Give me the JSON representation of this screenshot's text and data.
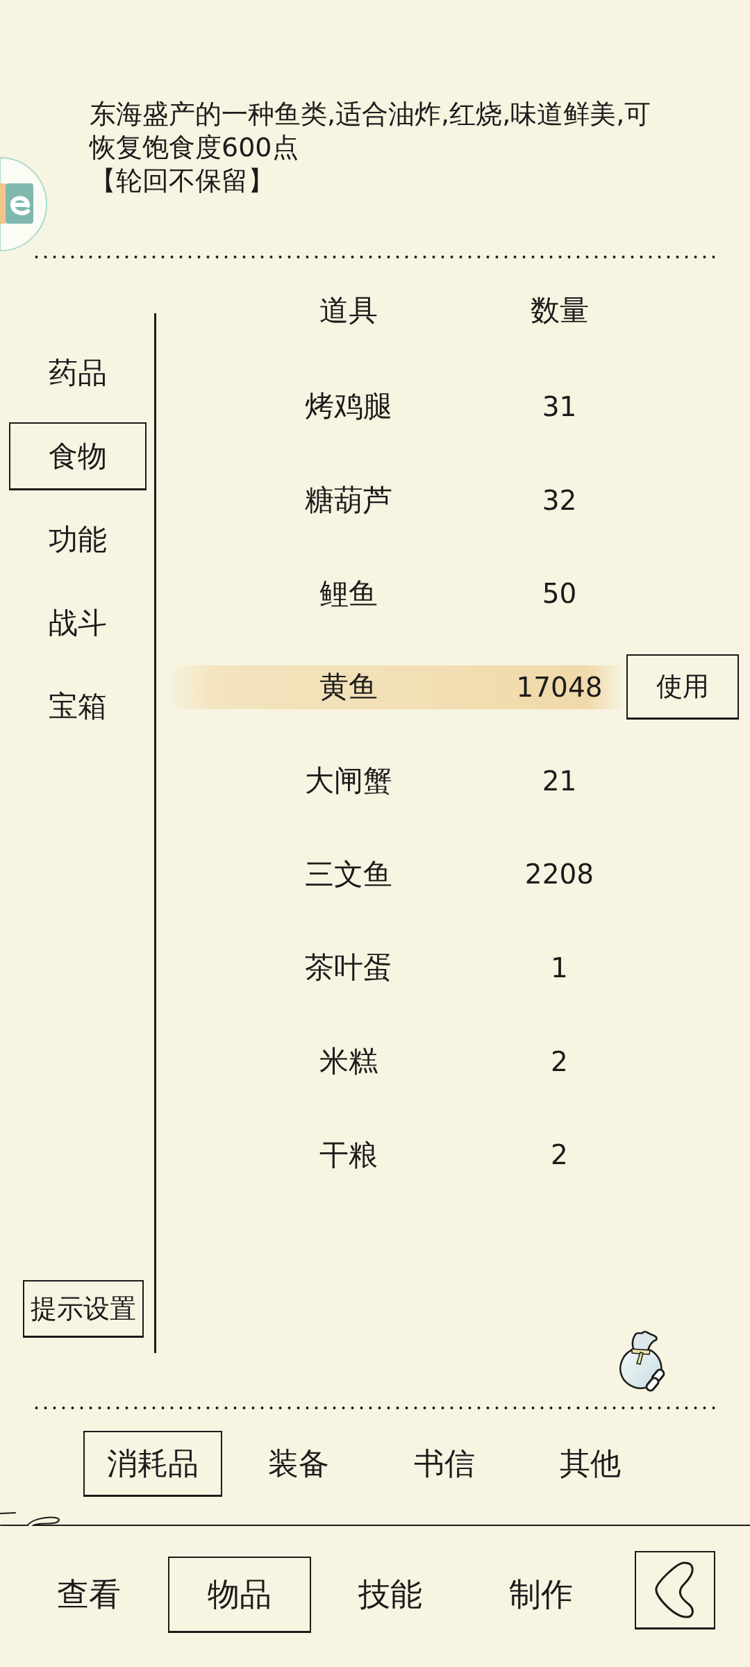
{
  "description": {
    "text": "东海盛产的一种鱼类,适合油炸,红烧,味道鲜美,可恢复饱食度600点",
    "note": "【轮回不保留】"
  },
  "sidebar": {
    "items": [
      {
        "label": "药品",
        "selected": false
      },
      {
        "label": "食物",
        "selected": true
      },
      {
        "label": "功能",
        "selected": false
      },
      {
        "label": "战斗",
        "selected": false
      },
      {
        "label": "宝箱",
        "selected": false
      }
    ],
    "settings_button": "提示设置"
  },
  "table": {
    "columns": [
      "道具",
      "数量"
    ],
    "rows": [
      {
        "name": "烤鸡腿",
        "count": "31",
        "selected": false
      },
      {
        "name": "糖葫芦",
        "count": "32",
        "selected": false
      },
      {
        "name": "鲤鱼",
        "count": "50",
        "selected": false
      },
      {
        "name": "黄鱼",
        "count": "17048",
        "selected": true,
        "action": "使用"
      },
      {
        "name": "大闸蟹",
        "count": "21",
        "selected": false
      },
      {
        "name": "三文鱼",
        "count": "2208",
        "selected": false
      },
      {
        "name": "茶叶蛋",
        "count": "1",
        "selected": false
      },
      {
        "name": "米糕",
        "count": "2",
        "selected": false
      },
      {
        "name": "干粮",
        "count": "2",
        "selected": false
      }
    ]
  },
  "category_tabs": [
    {
      "label": "消耗品",
      "selected": true
    },
    {
      "label": "装备",
      "selected": false
    },
    {
      "label": "书信",
      "selected": false
    },
    {
      "label": "其他",
      "selected": false
    }
  ],
  "bottom_nav": {
    "tabs": [
      {
        "label": "查看",
        "selected": false
      },
      {
        "label": "物品",
        "selected": true
      },
      {
        "label": "技能",
        "selected": false
      },
      {
        "label": "制作",
        "selected": false
      }
    ]
  }
}
